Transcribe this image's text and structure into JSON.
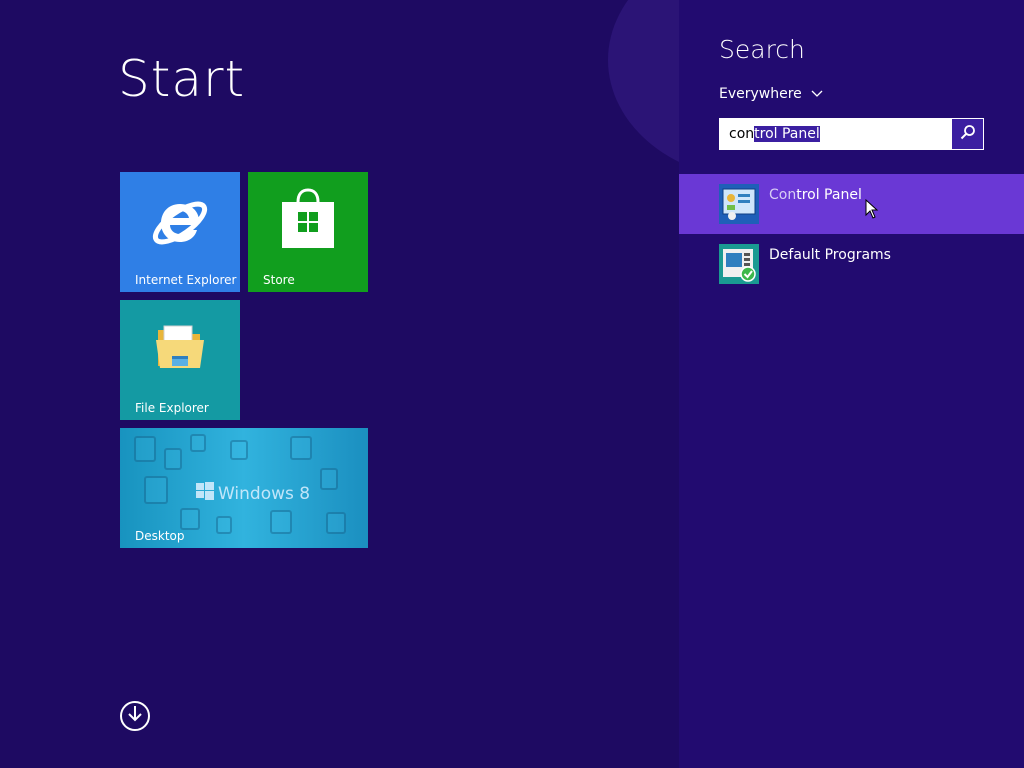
{
  "start": {
    "title": "Start",
    "tiles": [
      {
        "label": "Internet Explorer",
        "icon": "internet-explorer-icon"
      },
      {
        "label": "Store",
        "icon": "store-icon"
      },
      {
        "label": "File Explorer",
        "icon": "file-explorer-icon"
      },
      {
        "label": "Desktop",
        "brand": "Windows 8",
        "icon": "windows-logo-icon"
      }
    ],
    "apps_arrow_icon": "down-arrow-icon"
  },
  "search": {
    "title": "Search",
    "scope": "Everywhere",
    "query_unselected": "con",
    "query_selected": "trol Panel",
    "button_icon": "search-icon",
    "results": [
      {
        "label_dim": "Con",
        "label_rest": "trol Panel",
        "icon": "control-panel-icon",
        "selected": true
      },
      {
        "label": "Default Programs",
        "icon": "default-programs-icon",
        "selected": false
      }
    ]
  },
  "colors": {
    "start_background": "#1e0a62",
    "charm_background": "#220b70",
    "selected_result": "#6a38d5",
    "accent": "#3b1fa1",
    "ie_tile": "#2f7fe6",
    "store_tile": "#119e1e",
    "explorer_tile": "#149aa3"
  }
}
